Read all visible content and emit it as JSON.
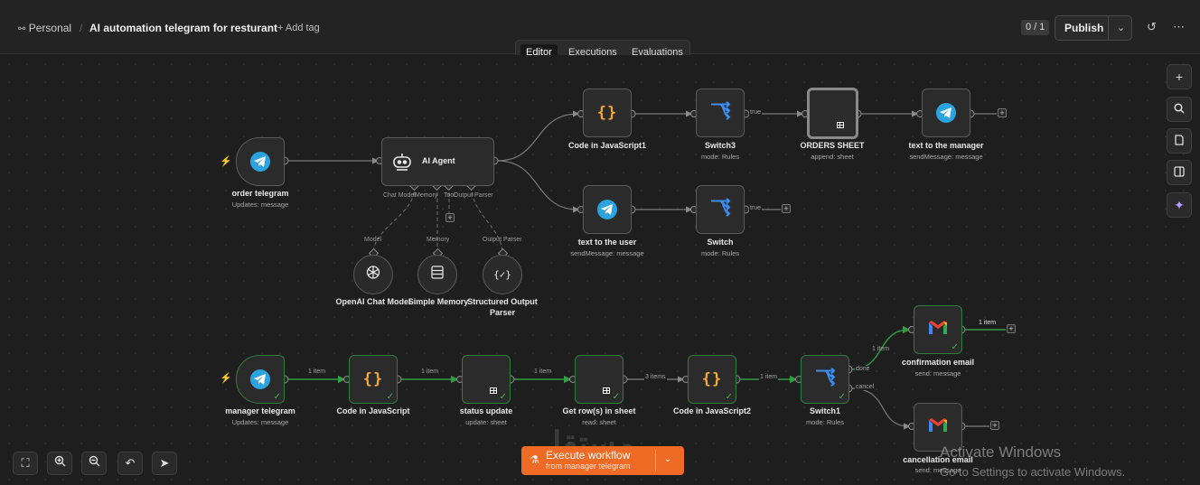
{
  "header": {
    "workspace": "Personal",
    "separator": "/",
    "title": "AI automation telegram for resturant",
    "add_tag": "+ Add tag",
    "counter": "0 / 1",
    "publish_label": "Publish"
  },
  "tabs": [
    {
      "label": "Editor",
      "active": true
    },
    {
      "label": "Executions",
      "active": false
    },
    {
      "label": "Evaluations",
      "active": false
    }
  ],
  "nodes": {
    "order_telegram": {
      "name": "order telegram",
      "sub": "Updates: message"
    },
    "ai_agent": {
      "name": "AI Agent",
      "ports": [
        "Chat Model",
        "Memory",
        "Tool",
        "Output Parser"
      ]
    },
    "code_js1": {
      "name": "Code in JavaScript1",
      "sub": ""
    },
    "switch3": {
      "name": "Switch3",
      "sub": "mode: Rules"
    },
    "orders_sheet": {
      "name": "ORDERS SHEET",
      "sub": "append: sheet"
    },
    "text_manager": {
      "name": "text to the manager",
      "sub": "sendMessage: message"
    },
    "text_user": {
      "name": "text to the user",
      "sub": "sendMessage: message"
    },
    "switch": {
      "name": "Switch",
      "sub": "mode: Rules"
    },
    "openai": {
      "name": "OpenAI Chat Model",
      "port": "Model"
    },
    "memory": {
      "name": "Simple Memory",
      "port": "Memory"
    },
    "parser": {
      "name": "Structured Output",
      "name2": "Parser",
      "port": "Output Parser"
    },
    "manager_telegram": {
      "name": "manager telegram",
      "sub": "Updates: message"
    },
    "code_js": {
      "name": "Code in JavaScript",
      "sub": ""
    },
    "status_update": {
      "name": "status update",
      "sub": "update: sheet"
    },
    "get_rows": {
      "name": "Get row(s) in sheet",
      "sub": "read: sheet"
    },
    "code_js2": {
      "name": "Code in JavaScript2",
      "sub": ""
    },
    "switch1": {
      "name": "Switch1",
      "sub": "mode: Rules"
    },
    "confirmation": {
      "name": "confirmation email",
      "sub": "send: message"
    },
    "cancellation": {
      "name": "cancellation email",
      "sub": "send: message"
    }
  },
  "edge_labels": {
    "true_label": "true",
    "one_item": "1 item",
    "three_items": "3 items",
    "done": "done",
    "cancel": "cancel"
  },
  "execute": {
    "label": "Execute workflow",
    "sub": "from manager telegram"
  },
  "overlay": {
    "watermark": "مستقل",
    "activate_title": "Activate Windows",
    "activate_sub": "Go to Settings to activate Windows."
  },
  "colors": {
    "accent_orange": "#ef6a25",
    "success_green": "#3fb24f",
    "telegram_blue": "#2aa3de",
    "sheets_green": "#23a455",
    "switch_blue": "#3b8ef0",
    "code_orange": "#f4a83a"
  },
  "icons": [
    "user-icon",
    "telegram-icon",
    "robot-icon",
    "code-braces-icon",
    "switch-icon",
    "sheets-icon",
    "gmail-icon",
    "openai-icon",
    "database-icon",
    "parser-icon",
    "plus-icon",
    "search-icon",
    "note-icon",
    "panel-icon",
    "sparkle-icon",
    "history-icon",
    "more-icon",
    "fit-view-icon",
    "zoom-in-icon",
    "zoom-out-icon",
    "undo-icon",
    "cleanup-icon",
    "flask-icon",
    "chevron-down-icon"
  ]
}
